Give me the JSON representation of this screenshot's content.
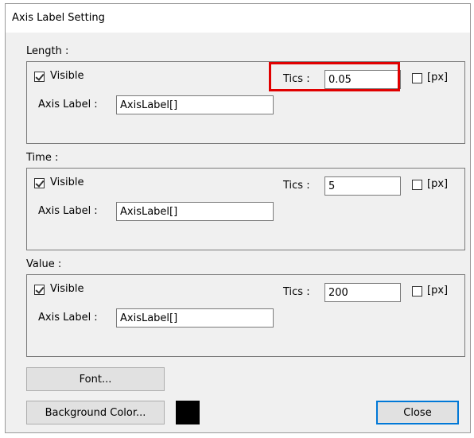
{
  "window": {
    "title": "Axis Label Setting"
  },
  "groups": [
    {
      "label": "Length :",
      "visible_label": "Visible",
      "visible_checked": true,
      "tics_label": "Tics :",
      "tics_value": "0.05",
      "px_label": "[px]",
      "px_checked": false,
      "axis_label_label": "Axis Label :",
      "axis_label_value": "AxisLabel[]"
    },
    {
      "label": "Time :",
      "visible_label": "Visible",
      "visible_checked": true,
      "tics_label": "Tics :",
      "tics_value": "5",
      "px_label": "[px]",
      "px_checked": false,
      "axis_label_label": "Axis Label :",
      "axis_label_value": "AxisLabel[]"
    },
    {
      "label": "Value :",
      "visible_label": "Visible",
      "visible_checked": true,
      "tics_label": "Tics :",
      "tics_value": "200",
      "px_label": "[px]",
      "px_checked": false,
      "axis_label_label": "Axis Label :",
      "axis_label_value": "AxisLabel[]"
    }
  ],
  "buttons": {
    "font": "Font...",
    "background_color": "Background Color...",
    "close": "Close"
  },
  "background_color_value": "#000000",
  "highlight_color": "#e00000"
}
